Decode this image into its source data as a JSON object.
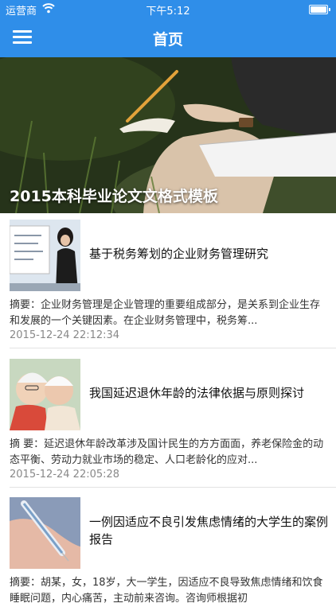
{
  "status_bar": {
    "carrier": "运营商",
    "time": "下午5:12"
  },
  "nav": {
    "title": "首页",
    "menu_icon": "hamburger-menu-icon"
  },
  "hero": {
    "caption": "2015本科毕业论文文格式模板"
  },
  "articles": [
    {
      "title": "基于税务筹划的企业财务管理研究",
      "summary": "摘要：企业财务管理是企业管理的重要组成部分，是关系到企业生存和发展的一个关键因素。在企业财务管理中，税务筹...",
      "date": "2015-12-24 22:12:34"
    },
    {
      "title": "我国延迟退休年龄的法律依据与原则探讨",
      "summary": "摘 要：延迟退休年龄改革涉及国计民生的方方面面，养老保险金的动态平衡、劳动力就业市场的稳定、人口老龄化的应对...",
      "date": "2015-12-24 22:05:28"
    },
    {
      "title": "一例因适应不良引发焦虑情绪的大学生的案例报告",
      "summary": "摘要：胡某，女，18岁，大一学生，因适应不良导致焦虑情绪和饮食睡眠问题，内心痛苦，主动前来咨询。咨询师根据初",
      "date": ""
    }
  ],
  "colors": {
    "nav_bar": "#2f8ee9",
    "title_text": "#111111",
    "date_text": "#888888"
  }
}
